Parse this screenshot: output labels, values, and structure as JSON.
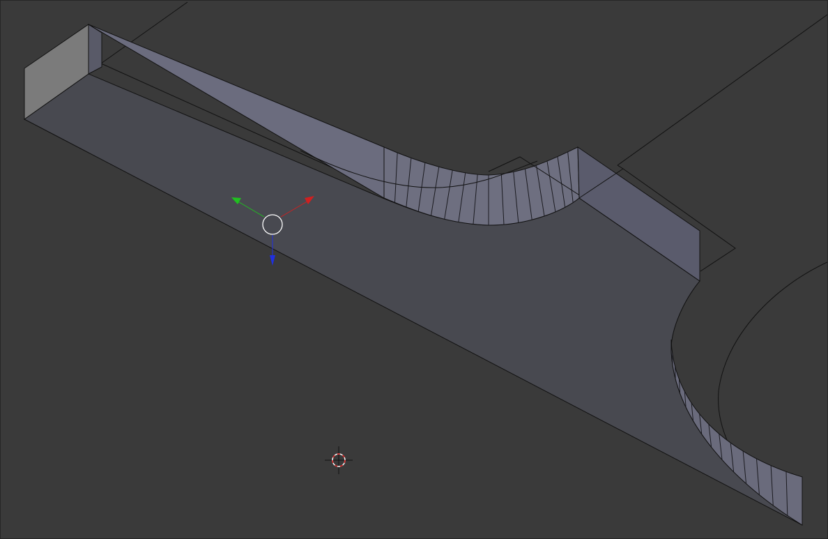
{
  "viewport": {
    "background": "#3a3a3a",
    "editor": "3D Viewport"
  },
  "mesh": {
    "top_face_color": "#484950",
    "inner_wall_color": "#6b6c7e",
    "end_cap_color": "#7a7a7a",
    "edge_color": "#111111"
  },
  "gizmo": {
    "icon": "transform-manipulator-icon",
    "x_axis_color": "#d02020",
    "y_axis_color": "#20c020",
    "z_axis_color": "#2030e0",
    "center_ring_color": "#ffffff"
  },
  "cursor": {
    "icon": "3d-cursor-icon",
    "ring_colors": [
      "#ffffff",
      "#e02020"
    ]
  }
}
